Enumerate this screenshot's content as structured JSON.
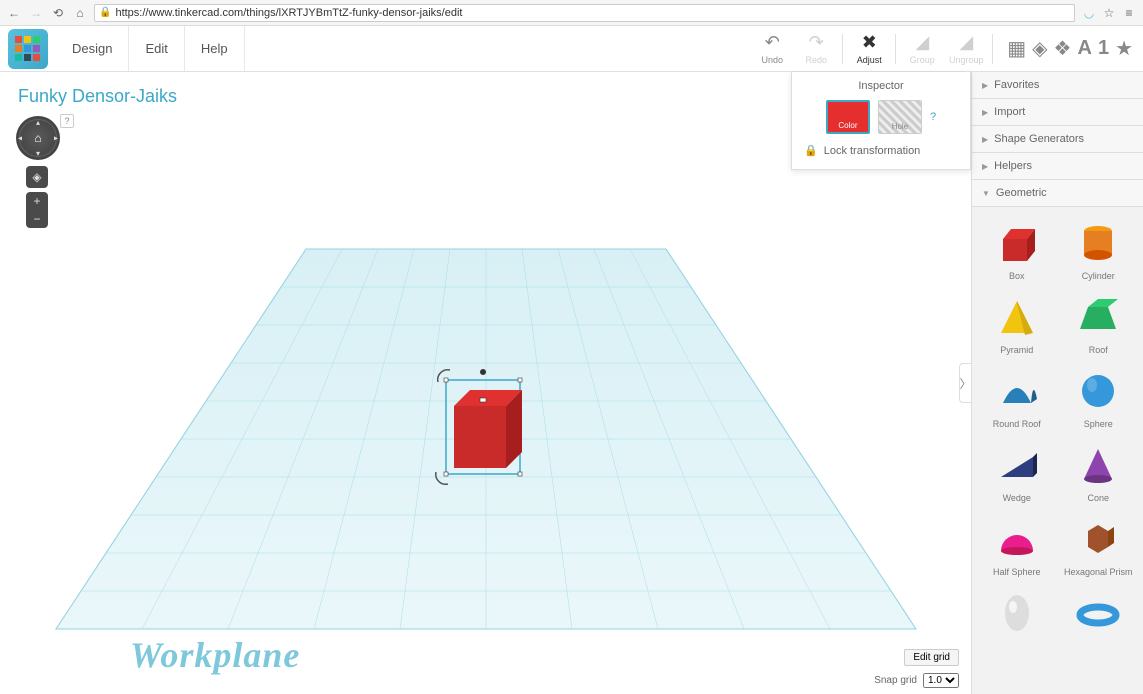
{
  "browser": {
    "url": "https://www.tinkercad.com/things/lXRTJYBmTtZ-funky-densor-jaiks/edit"
  },
  "menu": {
    "design": "Design",
    "edit": "Edit",
    "help": "Help"
  },
  "tools": {
    "undo": "Undo",
    "redo": "Redo",
    "adjust": "Adjust",
    "group": "Group",
    "ungroup": "Ungroup"
  },
  "project": {
    "title": "Funky Densor-Jaiks"
  },
  "workplane": {
    "label": "Workplane"
  },
  "inspector": {
    "title": "Inspector",
    "color": "Color",
    "hole": "Hole",
    "lock": "Lock transformation",
    "help": "?"
  },
  "grid": {
    "edit": "Edit grid",
    "snap_label": "Snap grid",
    "snap_value": "1.0"
  },
  "library": {
    "sections": {
      "favorites": "Favorites",
      "import": "Import",
      "generators": "Shape Generators",
      "helpers": "Helpers",
      "geometric": "Geometric"
    },
    "shapes": [
      {
        "name": "Box"
      },
      {
        "name": "Cylinder"
      },
      {
        "name": "Pyramid"
      },
      {
        "name": "Roof"
      },
      {
        "name": "Round Roof"
      },
      {
        "name": "Sphere"
      },
      {
        "name": "Wedge"
      },
      {
        "name": "Cone"
      },
      {
        "name": "Half Sphere"
      },
      {
        "name": "Hexagonal Prism"
      }
    ]
  }
}
